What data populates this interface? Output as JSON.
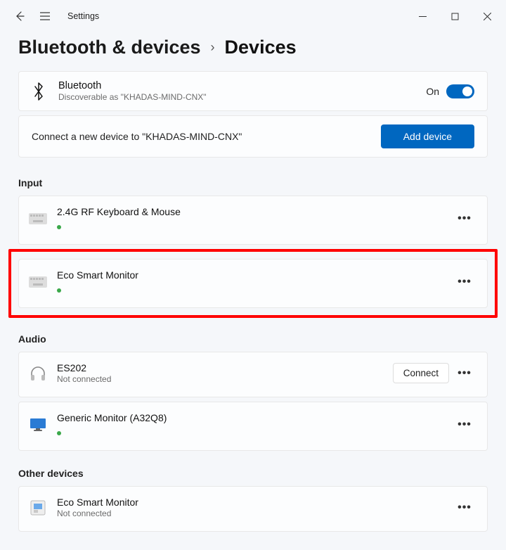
{
  "window": {
    "app_title": "Settings"
  },
  "breadcrumb": {
    "parent": "Bluetooth & devices",
    "current": "Devices"
  },
  "bluetooth": {
    "title": "Bluetooth",
    "subtitle": "Discoverable as \"KHADAS-MIND-CNX\"",
    "state_label": "On",
    "toggle_on": true
  },
  "add_device": {
    "prompt": "Connect a new device to \"KHADAS-MIND-CNX\"",
    "button_label": "Add device"
  },
  "sections": {
    "input": {
      "label": "Input",
      "items": [
        {
          "name": "2.4G RF Keyboard & Mouse",
          "status": "connected",
          "icon": "keyboard"
        },
        {
          "name": "Eco Smart Monitor",
          "status": "connected",
          "icon": "keyboard",
          "highlighted": true
        }
      ]
    },
    "audio": {
      "label": "Audio",
      "items": [
        {
          "name": "ES202",
          "subtitle": "Not connected",
          "icon": "headphones",
          "connect_button": "Connect"
        },
        {
          "name": "Generic Monitor (A32Q8)",
          "status": "connected",
          "icon": "monitor"
        }
      ]
    },
    "other": {
      "label": "Other devices",
      "items": [
        {
          "name": "Eco Smart Monitor",
          "subtitle": "Not connected",
          "icon": "device-generic"
        }
      ]
    }
  },
  "buttons": {
    "more": "•••"
  }
}
